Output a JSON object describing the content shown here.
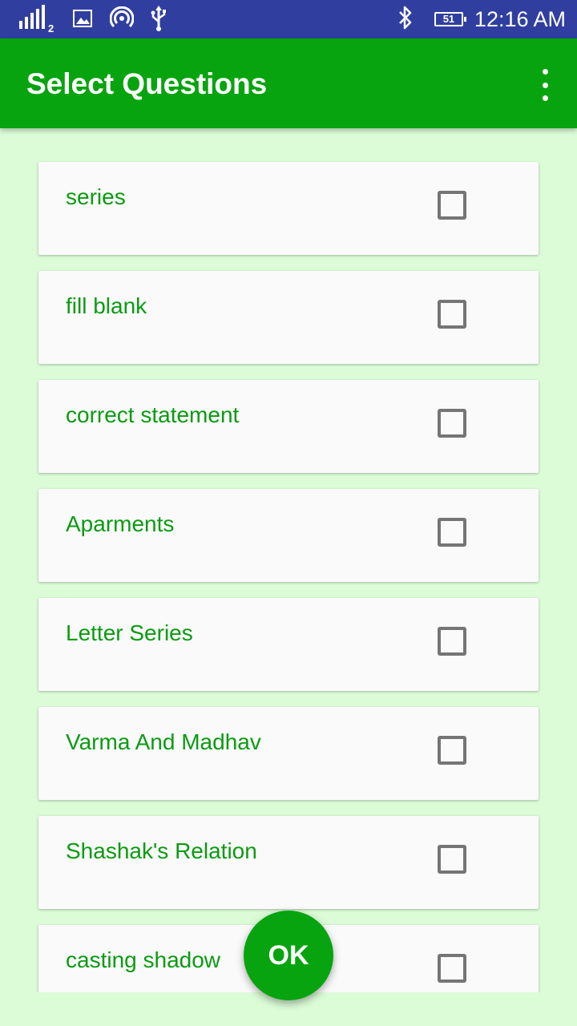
{
  "status_bar": {
    "signal_sim": "2",
    "battery_level": "51",
    "time": "12:16 AM",
    "icons": [
      "signal-icon",
      "image-icon",
      "hotspot-icon",
      "usb-icon",
      "bluetooth-icon",
      "battery-icon"
    ]
  },
  "appbar": {
    "title": "Select Questions",
    "overflow_icon": "more-vert-icon"
  },
  "questions": [
    {
      "label": "series",
      "checked": false
    },
    {
      "label": "fill blank",
      "checked": false
    },
    {
      "label": "correct statement",
      "checked": false
    },
    {
      "label": "Aparments",
      "checked": false
    },
    {
      "label": "Letter Series",
      "checked": false
    },
    {
      "label": "Varma And Madhav",
      "checked": false
    },
    {
      "label": "Shashak's Relation",
      "checked": false
    },
    {
      "label": "casting shadow",
      "checked": false
    }
  ],
  "fab": {
    "label": "OK"
  },
  "colors": {
    "status_bar": "#303f9f",
    "app_bar": "#07a40f",
    "background": "#dcfcd8",
    "card": "#fafafa",
    "label_text": "#0b9b12",
    "checkbox_border": "#757575"
  }
}
